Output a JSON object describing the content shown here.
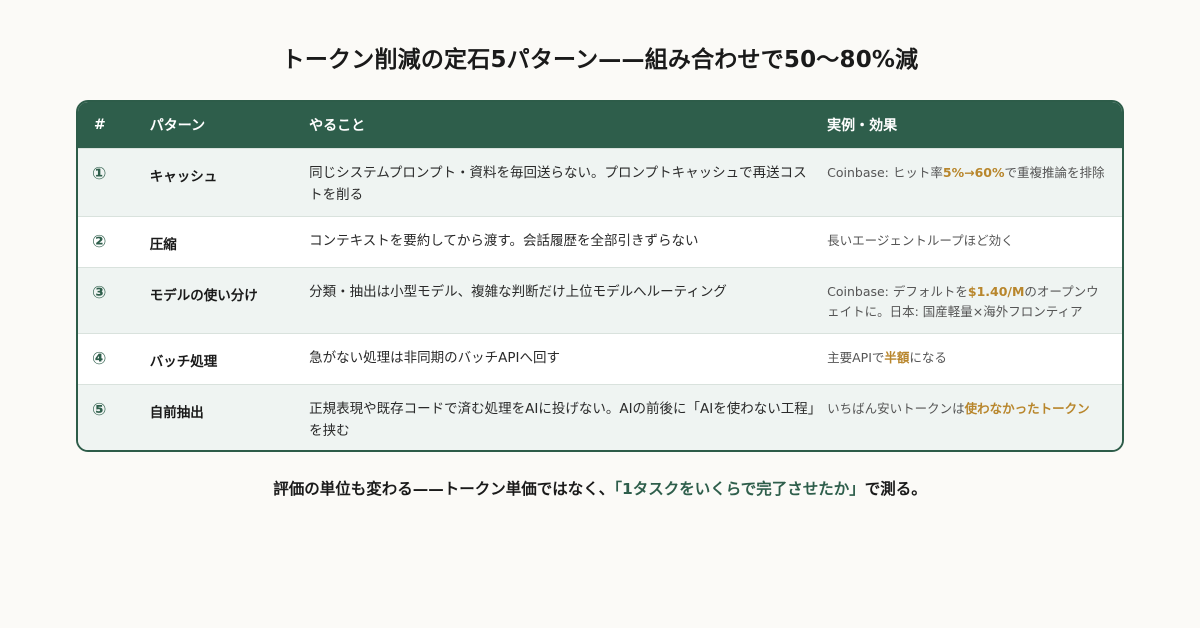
{
  "title": "トークン削減の定石5パターン——組み合わせで50〜80%減",
  "table": {
    "headers": {
      "num": "#",
      "pattern": "パターン",
      "action": "やること",
      "effect": "実例・効果"
    },
    "rows": [
      {
        "num": "①",
        "pattern": "キャッシュ",
        "action": "同じシステムプロンプト・資料を毎回送らない。プロンプトキャッシュで再送コストを削る",
        "effect_pre": "Coinbase: ヒット率",
        "effect_hl": "5%→60%",
        "effect_post": "で重複推論を排除"
      },
      {
        "num": "②",
        "pattern": "圧縮",
        "action": "コンテキストを要約してから渡す。会話履歴を全部引きずらない",
        "effect_pre": "長いエージェントループほど効く",
        "effect_hl": "",
        "effect_post": ""
      },
      {
        "num": "③",
        "pattern": "モデルの使い分け",
        "action": "分類・抽出は小型モデル、複雑な判断だけ上位モデルへルーティング",
        "effect_pre": "Coinbase: デフォルトを",
        "effect_hl": "$1.40/M",
        "effect_post": "のオープンウェイトに。日本: 国産軽量×海外フロンティア"
      },
      {
        "num": "④",
        "pattern": "バッチ処理",
        "action": "急がない処理は非同期のバッチAPIへ回す",
        "effect_pre": "主要APIで",
        "effect_hl": "半額",
        "effect_post": "になる"
      },
      {
        "num": "⑤",
        "pattern": "自前抽出",
        "action": "正規表現や既存コードで済む処理をAIに投げない。AIの前後に「AIを使わない工程」を挟む",
        "effect_pre": "いちばん安いトークンは",
        "effect_hl": "使わなかったトークン",
        "effect_post": ""
      }
    ]
  },
  "footer": {
    "pre": "評価の単位も変わる——トークン単価ではなく、",
    "accent": "「1タスクをいくらで完了させたか」",
    "post": "で測る。"
  },
  "colors": {
    "header_bg": "#2e5e4b",
    "highlight": "#b8862c",
    "alt_row": "#eff4f2"
  }
}
